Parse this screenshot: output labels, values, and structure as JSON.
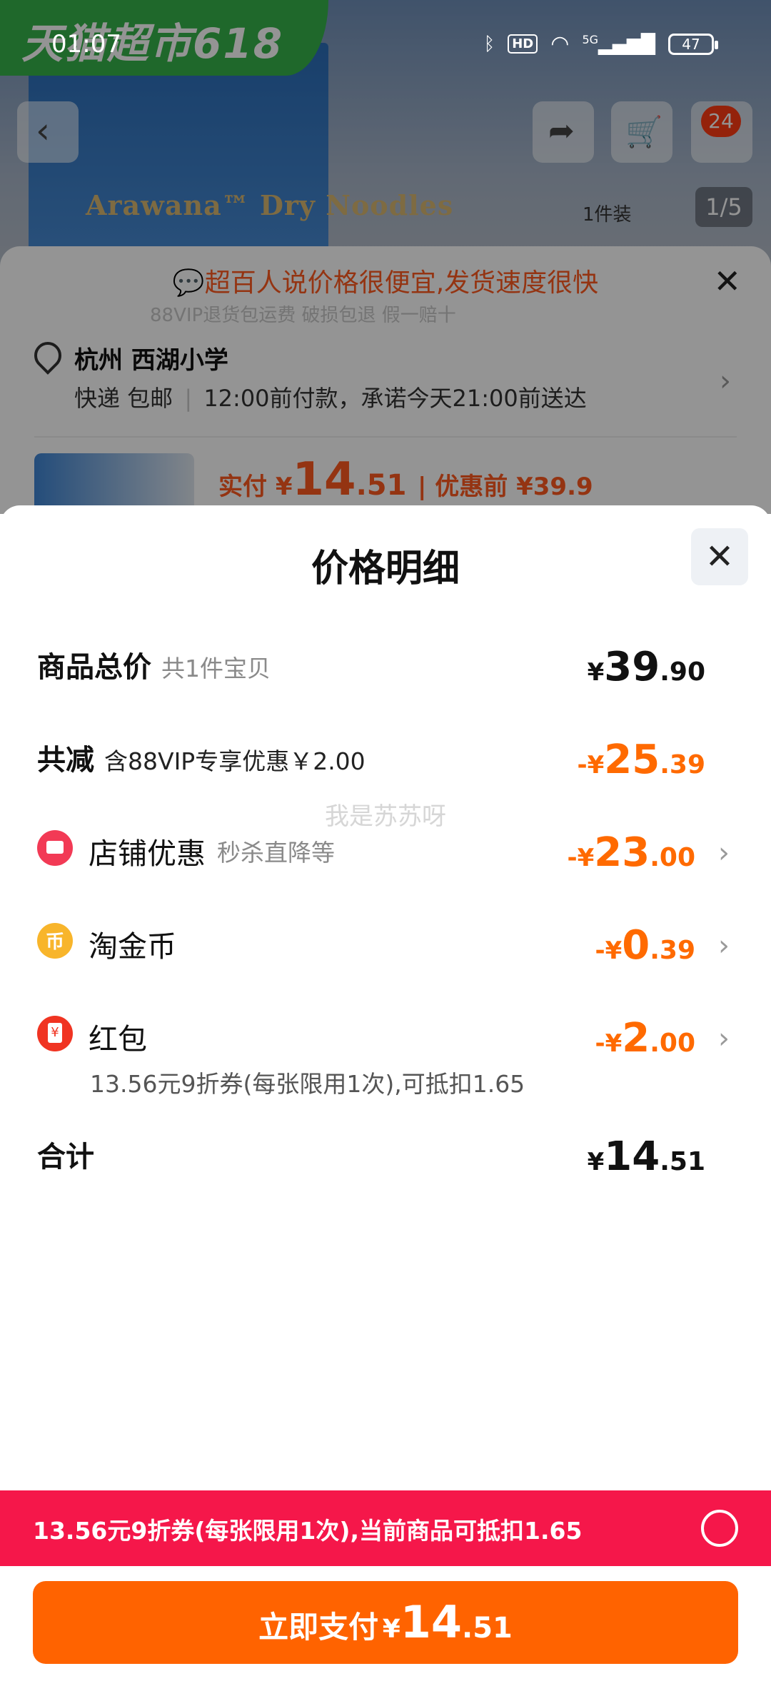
{
  "status_bar": {
    "time": "01:07",
    "hd": "HD",
    "network": "5G",
    "battery": "47"
  },
  "background": {
    "promo_banner": "天猫超市618",
    "product_text": "Arawana™ Dry Noodles",
    "pack_label": "1件装",
    "page_indicator": "1/5",
    "cart_badge": "24",
    "back_sheet": {
      "header": "超百人说价格很便宜,发货速度很快",
      "sub_text": "88VIP退货包运费 破损包退 假一赔十",
      "location_title": "杭州 西湖小学",
      "delivery_method": "快递 包邮",
      "delivery_promise": "12:00前付款，承诺今天21:00前送达",
      "price_prefix": "实付 ¥",
      "price_int": "14",
      "price_dec": ".51",
      "price_before": "| 优惠前 ¥39.9"
    }
  },
  "sheet": {
    "title": "价格明细",
    "watermark": "我是苏苏呀",
    "total_goods": {
      "label": "商品总价",
      "sub": "共1件宝贝",
      "symbol": "¥",
      "int": "39",
      "dec": ".90"
    },
    "total_discount": {
      "label": "共减",
      "note": "含88VIP专享优惠￥2.00",
      "symbol": "-¥",
      "int": "25",
      "dec": ".39"
    },
    "items": [
      {
        "icon": "shop-icon",
        "label": "店铺优惠",
        "sub": "秒杀直降等",
        "symbol": "-¥",
        "int": "23",
        "dec": ".00"
      },
      {
        "icon": "coin-icon",
        "label": "淘金币",
        "sub": "",
        "symbol": "-¥",
        "int": "0",
        "dec": ".39"
      },
      {
        "icon": "red-packet-icon",
        "label": "红包",
        "sub": "",
        "detail": "13.56元9折券(每张限用1次),可抵扣1.65",
        "symbol": "-¥",
        "int": "2",
        "dec": ".00"
      }
    ],
    "grand_total": {
      "label": "合计",
      "symbol": "¥",
      "int": "14",
      "dec": ".51"
    }
  },
  "coupon_bar": {
    "text": "13.56元9折券(每张限用1次),当前商品可抵扣1.65"
  },
  "pay_button": {
    "label": "立即支付",
    "symbol": "¥",
    "int": "14",
    "dec": ".51"
  },
  "colors": {
    "accent_orange": "#ff6300",
    "discount_orange": "#ff6a00",
    "coupon_red": "#f5174a"
  }
}
